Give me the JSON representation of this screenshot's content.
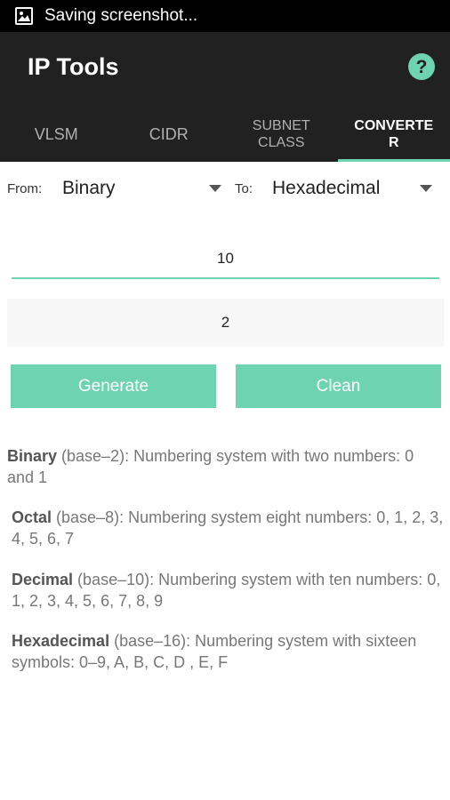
{
  "status_bar": {
    "notification_icon": "image-icon",
    "text": "Saving screenshot..."
  },
  "app_bar": {
    "title": "IP Tools",
    "help_icon": "help-circle-icon"
  },
  "tabs": [
    {
      "label": "VLSM",
      "active": false
    },
    {
      "label": "CIDR",
      "active": false
    },
    {
      "label": "SUBNET\nCLASS",
      "active": false
    },
    {
      "label": "CONVERTE\nR",
      "active": true
    }
  ],
  "converter": {
    "from_label": "From:",
    "from_value": "Binary",
    "to_label": "To:",
    "to_value": "Hexadecimal",
    "input_value": "10",
    "result_value": "2",
    "generate_label": "Generate",
    "clean_label": "Clean"
  },
  "info": [
    {
      "term": "Binary",
      "desc": " (base–2): Numbering system with two numbers: 0 and 1"
    },
    {
      "term": "Octal",
      "desc": " (base–8): Numbering system eight numbers: 0, 1, 2, 3, 4, 5, 6, 7"
    },
    {
      "term": "Decimal",
      "desc": " (base–10): Numbering system with ten numbers: 0, 1, 2, 3, 4, 5, 6, 7, 8, 9"
    },
    {
      "term": "Hexadecimal",
      "desc": " (base–16): Numbering system with sixteen symbols: 0–9, A, B, C, D , E, F"
    }
  ],
  "colors": {
    "accent": "#6dd3b0",
    "app_bar": "#212121",
    "status_bar": "#000000"
  }
}
